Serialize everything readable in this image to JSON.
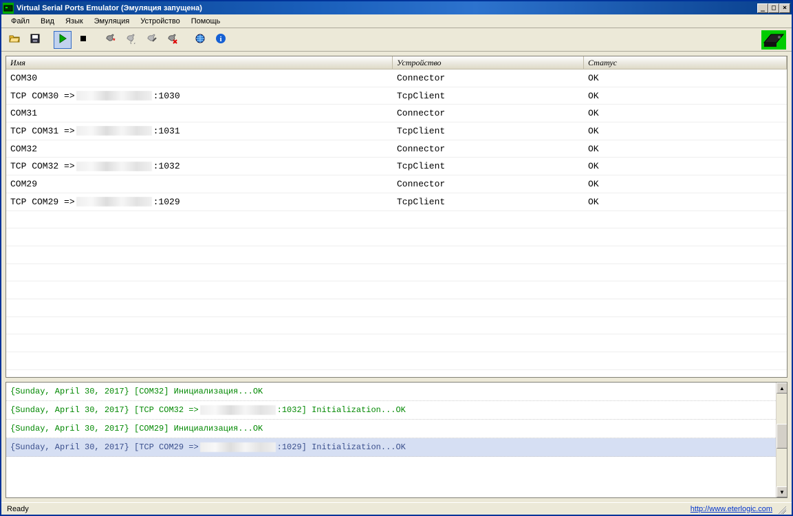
{
  "window": {
    "title": "Virtual Serial Ports Emulator (Эмуляция запущена)"
  },
  "menu": {
    "file": "Файл",
    "view": "Вид",
    "language": "Язык",
    "emulation": "Эмуляция",
    "device": "Устройство",
    "help": "Помощь"
  },
  "columns": {
    "name": "Имя",
    "device": "Устройство",
    "status": "Статус"
  },
  "rows": [
    {
      "name_prefix": "COM30",
      "name_suffix": "",
      "redacted": false,
      "device": "Connector",
      "status": "OK"
    },
    {
      "name_prefix": "TCP COM30 => ",
      "name_suffix": ":1030",
      "redacted": true,
      "device": "TcpClient",
      "status": "OK"
    },
    {
      "name_prefix": "COM31",
      "name_suffix": "",
      "redacted": false,
      "device": "Connector",
      "status": "OK"
    },
    {
      "name_prefix": "TCP COM31 => ",
      "name_suffix": ":1031",
      "redacted": true,
      "device": "TcpClient",
      "status": "OK"
    },
    {
      "name_prefix": "COM32",
      "name_suffix": "",
      "redacted": false,
      "device": "Connector",
      "status": "OK"
    },
    {
      "name_prefix": "TCP COM32 => ",
      "name_suffix": ":1032",
      "redacted": true,
      "device": "TcpClient",
      "status": "OK"
    },
    {
      "name_prefix": "COM29",
      "name_suffix": "",
      "redacted": false,
      "device": "Connector",
      "status": "OK"
    },
    {
      "name_prefix": "TCP COM29 => ",
      "name_suffix": ":1029",
      "redacted": true,
      "device": "TcpClient",
      "status": "OK"
    }
  ],
  "empty_rows": 9,
  "log": [
    {
      "prefix": "{Sunday, April 30, 2017} [COM32] Инициализация...OK",
      "redacted": false,
      "mid": "",
      "suffix": "",
      "selected": false
    },
    {
      "prefix": "{Sunday, April 30, 2017} [TCP COM32 => ",
      "redacted": true,
      "mid": "",
      "suffix": ":1032] Initialization...OK",
      "selected": false
    },
    {
      "prefix": "{Sunday, April 30, 2017} [COM29] Инициализация...OK",
      "redacted": false,
      "mid": "",
      "suffix": "",
      "selected": false
    },
    {
      "prefix": "{Sunday, April 30, 2017} [TCP COM29 => ",
      "redacted": true,
      "mid": "",
      "suffix": ":1029] Initialization...OK",
      "selected": true
    }
  ],
  "status": {
    "ready": "Ready",
    "link": "http://www.eterlogic.com"
  }
}
